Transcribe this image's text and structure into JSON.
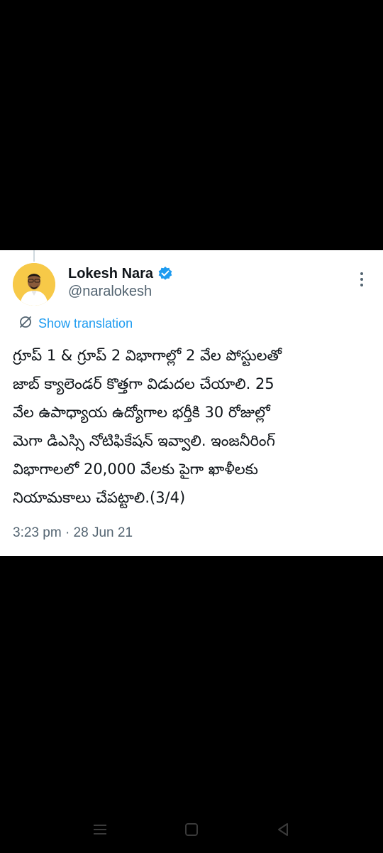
{
  "tweet": {
    "display_name": "Lokesh Nara",
    "handle": "@naralokesh",
    "show_translation_label": "Show translation",
    "text_lines": [
      "గ్రూప్ 1 & గ్రూప్ 2 విభాగాల్లో 2 వేల పోస్టులతో",
      "జాబ్ క్యాలెండర్ కొత్తగా విడుదల చేయాలి. 25",
      "వేల ఉపాధ్యాయ ఉద్యోగాల భర్తీకి 30 రోజుల్లో",
      "మెగా డిఎస్సి నోటిఫికేషన్ ఇవ్వాలి. ఇంజనీరింగ్",
      "విభాగాలలో 20,000 వేలకు పైగా ఖాళీలకు",
      "నియామకాలు చేపట్టాలి.(3/4)"
    ],
    "time": "3:23 pm",
    "separator": "·",
    "date": "28 Jun 21"
  },
  "icons": {
    "verified": "verified-badge-icon",
    "more": "more-vertical-icon",
    "translate": "translate-off-icon",
    "nav_recents": "recents-icon",
    "nav_home": "home-icon",
    "nav_back": "back-icon"
  },
  "colors": {
    "link": "#1d9bf0",
    "text": "#0f1419",
    "secondary": "#536471",
    "avatar_bg": "#f7c948"
  }
}
